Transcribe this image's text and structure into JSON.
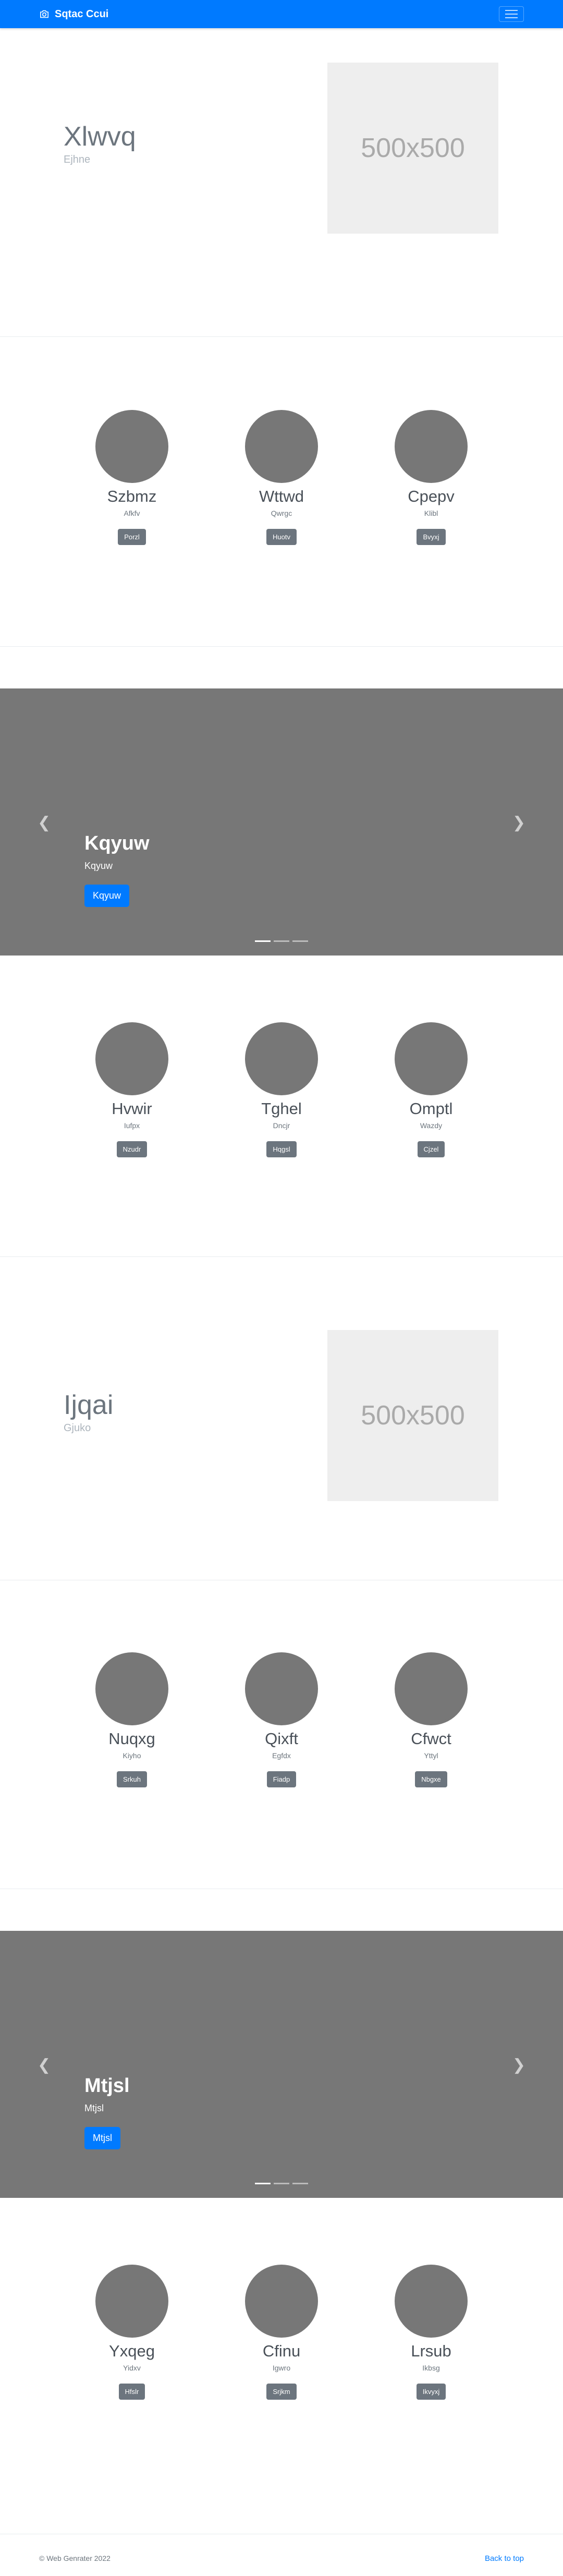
{
  "navbar": {
    "brand": "Sqtac Ccui",
    "brand_icon": "camera-icon",
    "menu_icon": "hamburger-icon"
  },
  "feature_1": {
    "title": "Xlwvq",
    "subtitle": "Ejhne",
    "image_text": "500x500"
  },
  "team_1": {
    "members": [
      {
        "name": "Szbmz",
        "role": "Afkfv",
        "button": "Porzl"
      },
      {
        "name": "Wttwd",
        "role": "Qwrgc",
        "button": "Huotv"
      },
      {
        "name": "Cpepv",
        "role": "Klibl",
        "button": "Bvyxj"
      }
    ]
  },
  "carousel_1": {
    "title": "Kqyuw",
    "text": "Kqyuw",
    "button": "Kqyuw",
    "slides": 3
  },
  "team_2": {
    "members": [
      {
        "name": "Hvwir",
        "role": "Iufpx",
        "button": "Nzudr"
      },
      {
        "name": "Tghel",
        "role": "Dncjr",
        "button": "Hqgsl"
      },
      {
        "name": "Omptl",
        "role": "Wazdy",
        "button": "Cjzel"
      }
    ]
  },
  "feature_2": {
    "title": "Ijqai",
    "subtitle": "Gjuko",
    "image_text": "500x500"
  },
  "team_3": {
    "members": [
      {
        "name": "Nuqxg",
        "role": "Kiyho",
        "button": "Srkuh"
      },
      {
        "name": "Qixft",
        "role": "Egfdx",
        "button": "Fiadp"
      },
      {
        "name": "Cfwct",
        "role": "Yttyl",
        "button": "Nbgxe"
      }
    ]
  },
  "carousel_2": {
    "title": "Mtjsl",
    "text": "Mtjsl",
    "button": "Mtjsl",
    "slides": 3
  },
  "team_4": {
    "members": [
      {
        "name": "Yxqeg",
        "role": "Yidxv",
        "button": "Hfslr"
      },
      {
        "name": "Cfinu",
        "role": "Igwro",
        "button": "Srjkm"
      },
      {
        "name": "Lrsub",
        "role": "Ikbsg",
        "button": "Ikvyxj"
      }
    ]
  },
  "footer": {
    "copyright": "© Web Genrater 2022",
    "back_to_top": "Back to top"
  },
  "colors": {
    "primary": "#007bff",
    "secondary": "#6c757d",
    "placeholder": "#777777"
  }
}
